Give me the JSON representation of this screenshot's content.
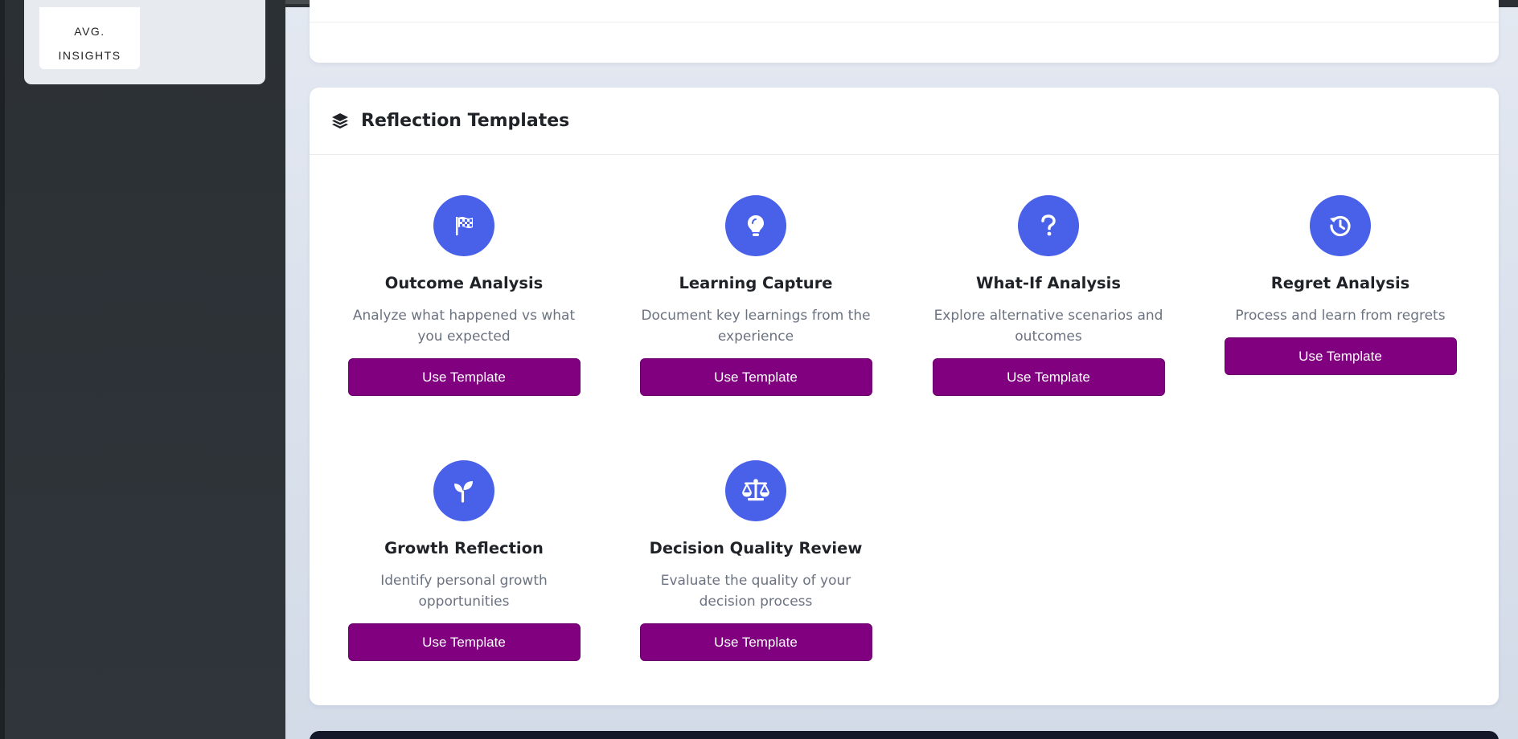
{
  "sidebar": {
    "stat": {
      "label": "AVG. INSIGHTS"
    }
  },
  "templates_section": {
    "title": "Reflection Templates",
    "header_icon": "layer-group-icon",
    "accent_color": "#4961e8",
    "button_color": "#800080",
    "items": [
      {
        "icon": "flag-checkered-icon",
        "title": "Outcome Analysis",
        "description": "Analyze what happened vs what you expected",
        "button_label": "Use Template"
      },
      {
        "icon": "lightbulb-icon",
        "title": "Learning Capture",
        "description": "Document key learnings from the experience",
        "button_label": "Use Template"
      },
      {
        "icon": "question-icon",
        "title": "What-If Analysis",
        "description": "Explore alternative scenarios and outcomes",
        "button_label": "Use Template"
      },
      {
        "icon": "history-icon",
        "title": "Regret Analysis",
        "description": "Process and learn from regrets",
        "button_label": "Use Template"
      },
      {
        "icon": "seedling-icon",
        "title": "Growth Reflection",
        "description": "Identify personal growth opportunities",
        "button_label": "Use Template"
      },
      {
        "icon": "balance-scale-icon",
        "title": "Decision Quality Review",
        "description": "Evaluate the quality of your decision process",
        "button_label": "Use Template"
      }
    ]
  }
}
